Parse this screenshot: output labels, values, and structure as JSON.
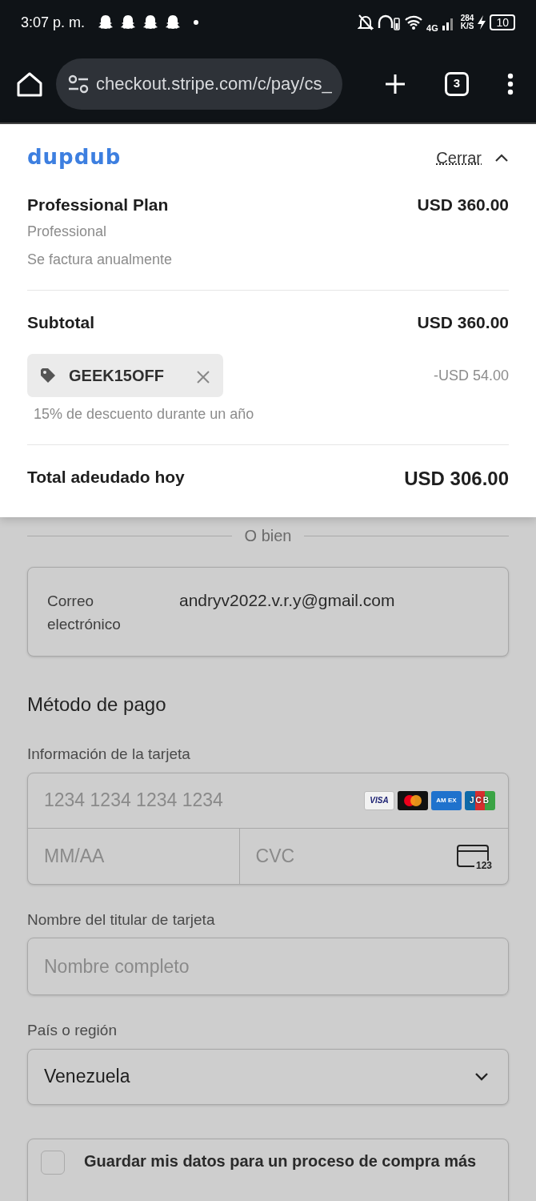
{
  "status_bar": {
    "time": "3:07 p. m.",
    "network": "4G",
    "speed": "284",
    "speed_unit": "K/S",
    "battery": "10"
  },
  "browser": {
    "url": "checkout.stripe.com/c/pay/cs_",
    "tab_count": "3"
  },
  "summary": {
    "logo": "dupdub",
    "toggle": "Cerrar",
    "expanded": true,
    "item": {
      "name": "Professional Plan",
      "price": "USD 360.00",
      "variant": "Professional",
      "billing": "Se factura anualmente"
    },
    "subtotal_label": "Subtotal",
    "subtotal": "USD 360.00",
    "promo": {
      "code": "GEEK15OFF",
      "discount": "-USD 54.00",
      "description": "15% de descuento durante un año"
    },
    "total_label": "Total adeudado hoy",
    "total": "USD 306.00"
  },
  "divider_text": "O bien",
  "email": {
    "label": "Correo electrónico",
    "value": "andryv2022.v.r.y@gmail.com"
  },
  "payment": {
    "title": "Método de pago",
    "card_label": "Información de la tarjeta",
    "card_number_placeholder": "1234 1234 1234 1234",
    "brands": [
      {
        "kind": "visa",
        "label": "VISA"
      },
      {
        "kind": "mastercard"
      },
      {
        "kind": "amex",
        "label": "AM EX"
      },
      {
        "kind": "jcb",
        "label": "JCB"
      }
    ],
    "expiry_placeholder": "MM/AA",
    "cvc_placeholder": "CVC",
    "cvc_icon_text": "123",
    "name_label": "Nombre del titular de tarjeta",
    "name_placeholder": "Nombre completo",
    "country_label": "País o región",
    "country": "Venezuela"
  },
  "save": {
    "label": "Guardar mis datos para un proceso de compra más",
    "checked": false
  }
}
